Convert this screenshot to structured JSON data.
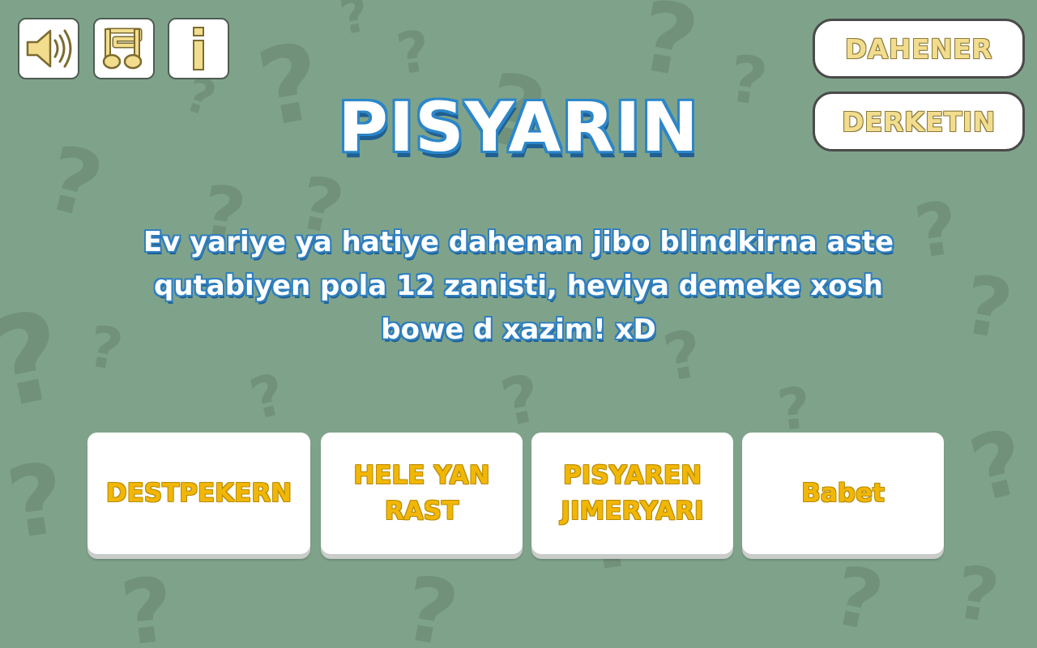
{
  "colors": {
    "background": "#7fa38a",
    "background_glyph": "#6f8f79",
    "title_outline": "#2c86c8",
    "gold_text": "#f2b705",
    "pale_gold_text": "#f2dc8e"
  },
  "toolbar": {
    "sound_icon": "speaker-icon",
    "music_icon": "music-note-icon",
    "info_label": "i"
  },
  "menu": {
    "help_label": "DAHENER",
    "exit_label": "DERKETIN"
  },
  "screen": {
    "title": "PISYARIN",
    "message_lines": [
      "Ev yariye ya hatiye dahenan jibo blindkirna aste",
      "qutabiyen pola 12 zanisti, heviya demeke xosh",
      "bowe d xazim! xD"
    ]
  },
  "answers": [
    {
      "lines": [
        "DESTPEKERN"
      ]
    },
    {
      "lines": [
        "HELE YAN",
        "RAST"
      ]
    },
    {
      "lines": [
        "PISYAREN",
        "JIMERYARI"
      ]
    },
    {
      "lines": [
        "Babet"
      ]
    }
  ]
}
